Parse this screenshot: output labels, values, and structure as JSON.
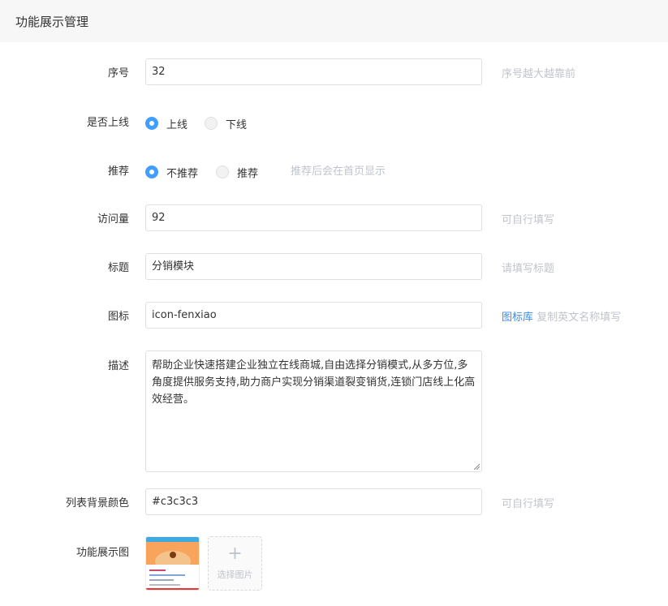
{
  "header": {
    "title": "功能展示管理"
  },
  "form": {
    "order": {
      "label": "序号",
      "value": "32",
      "hint": "序号越大越靠前"
    },
    "online": {
      "label": "是否上线",
      "options": [
        "上线",
        "下线"
      ],
      "selected": "上线"
    },
    "recommend": {
      "label": "推荐",
      "options": [
        "不推荐",
        "推荐"
      ],
      "selected": "不推荐",
      "hint": "推荐后会在首页显示"
    },
    "views": {
      "label": "访问量",
      "value": "92",
      "hint": "可自行填写"
    },
    "title": {
      "label": "标题",
      "value": "分销模块",
      "hint": "请填写标题"
    },
    "icon": {
      "label": "图标",
      "value": "icon-fenxiao",
      "hint_link": "图标库",
      "hint": "复制英文名称填写"
    },
    "description": {
      "label": "描述",
      "value": "帮助企业快速搭建企业独立在线商城,自由选择分销模式,从多方位,多角度提供服务支持,助力商户实现分销渠道裂变销货,连锁门店线上化高效经营。"
    },
    "bg_color": {
      "label": "列表背景颜色",
      "value": "#c3c3c3",
      "hint": "可自行填写"
    },
    "image": {
      "label": "功能展示图",
      "upload_plus": "+",
      "upload_text": "选择图片"
    }
  },
  "colors": {
    "accent": "#409eff",
    "hint": "#c0c4cc",
    "link": "#3a8ee6",
    "header_bg": "#f7f7f7"
  }
}
